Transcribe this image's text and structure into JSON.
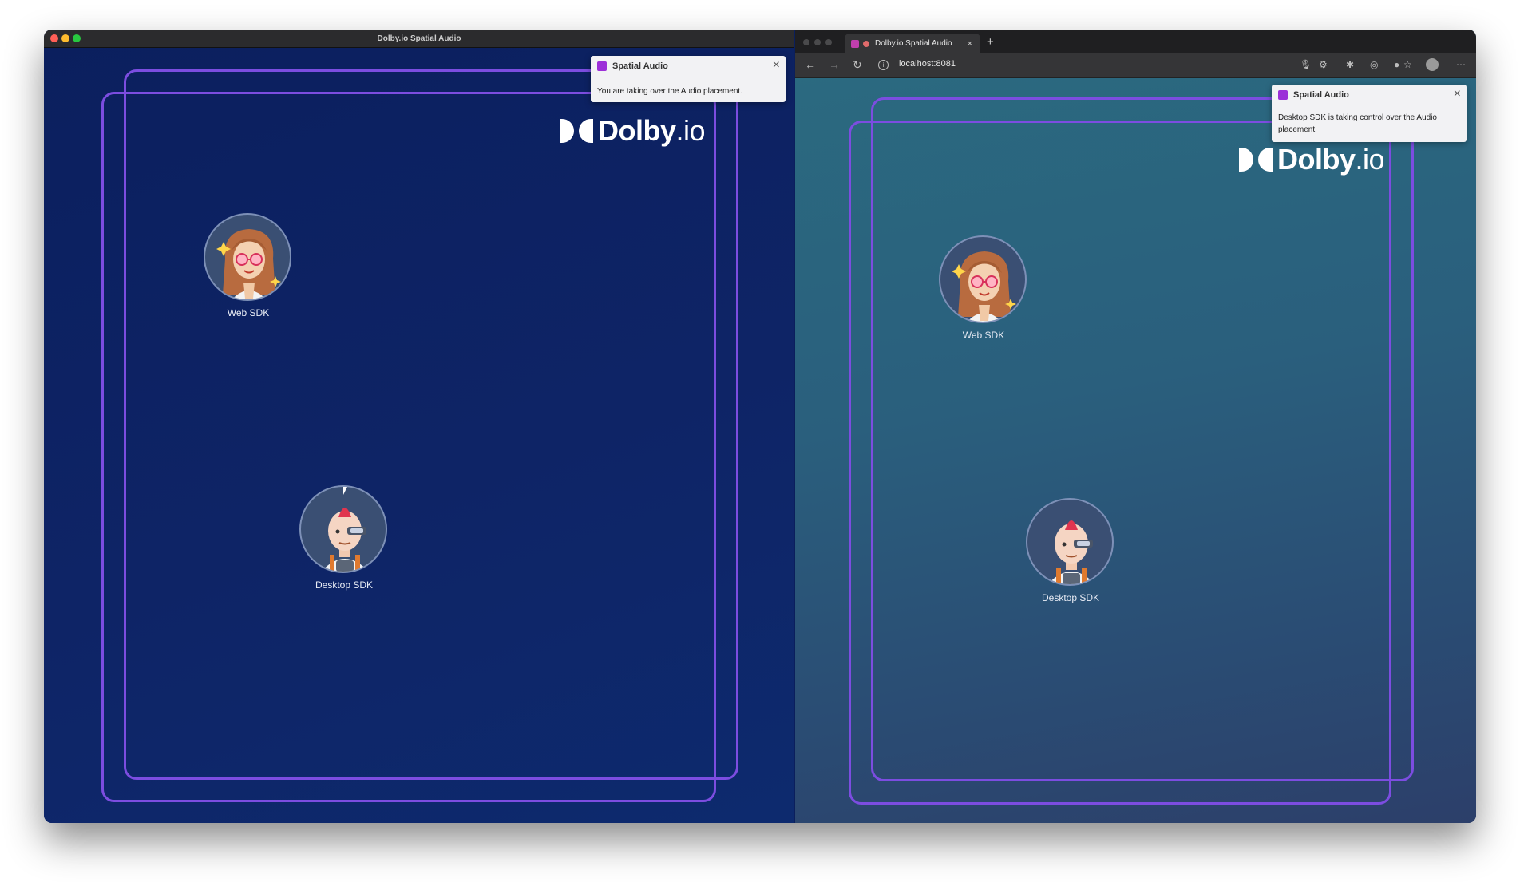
{
  "left_window": {
    "title": "Dolby.io Spatial Audio",
    "logo": {
      "brand": "Dolby",
      "suffix": ".io"
    },
    "toast": {
      "title": "Spatial Audio",
      "message": "You are taking over the Audio placement.",
      "close_icon": "close-icon"
    },
    "participants": [
      {
        "label": "Web SDK",
        "icon": "woman-glasses-avatar"
      },
      {
        "label": "Desktop SDK",
        "icon": "robot-man-avatar"
      }
    ]
  },
  "browser": {
    "tab_title": "Dolby.io Spatial Audio",
    "url": "localhost:8081",
    "new_tab_symbol": "+",
    "logo": {
      "brand": "Dolby",
      "suffix": ".io"
    },
    "toast": {
      "title": "Spatial Audio",
      "message": "Desktop SDK is taking control over the Audio placement.",
      "close_icon": "close-icon"
    },
    "participants": [
      {
        "label": "Web SDK",
        "icon": "woman-glasses-avatar"
      },
      {
        "label": "Desktop SDK",
        "icon": "robot-man-avatar"
      }
    ]
  },
  "colors": {
    "frame": "#7c4de0",
    "left_background": "#0e2466",
    "right_background": "#2a5f7d",
    "toast_icon": "#9c2fd8"
  }
}
